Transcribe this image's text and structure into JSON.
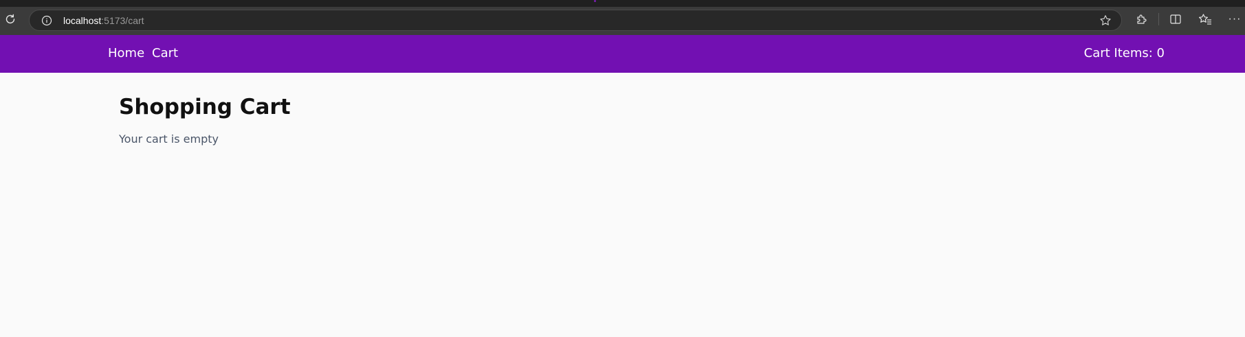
{
  "browser": {
    "url_host": "localhost",
    "url_rest": ":5173/cart",
    "icons": {
      "reload": "reload-icon",
      "info": "info-icon",
      "star": "star-icon",
      "extensions": "extensions-icon",
      "split_screen": "split-screen-icon",
      "favorites": "favorites-icon",
      "more": "more-icon"
    },
    "more_glyph": "···"
  },
  "navbar": {
    "background": "#7210b2",
    "links": [
      {
        "label": "Home"
      },
      {
        "label": "Cart"
      }
    ],
    "cart_count_label": "Cart Items: 0"
  },
  "main": {
    "title": "Shopping Cart",
    "empty_message": "Your cart is empty"
  }
}
